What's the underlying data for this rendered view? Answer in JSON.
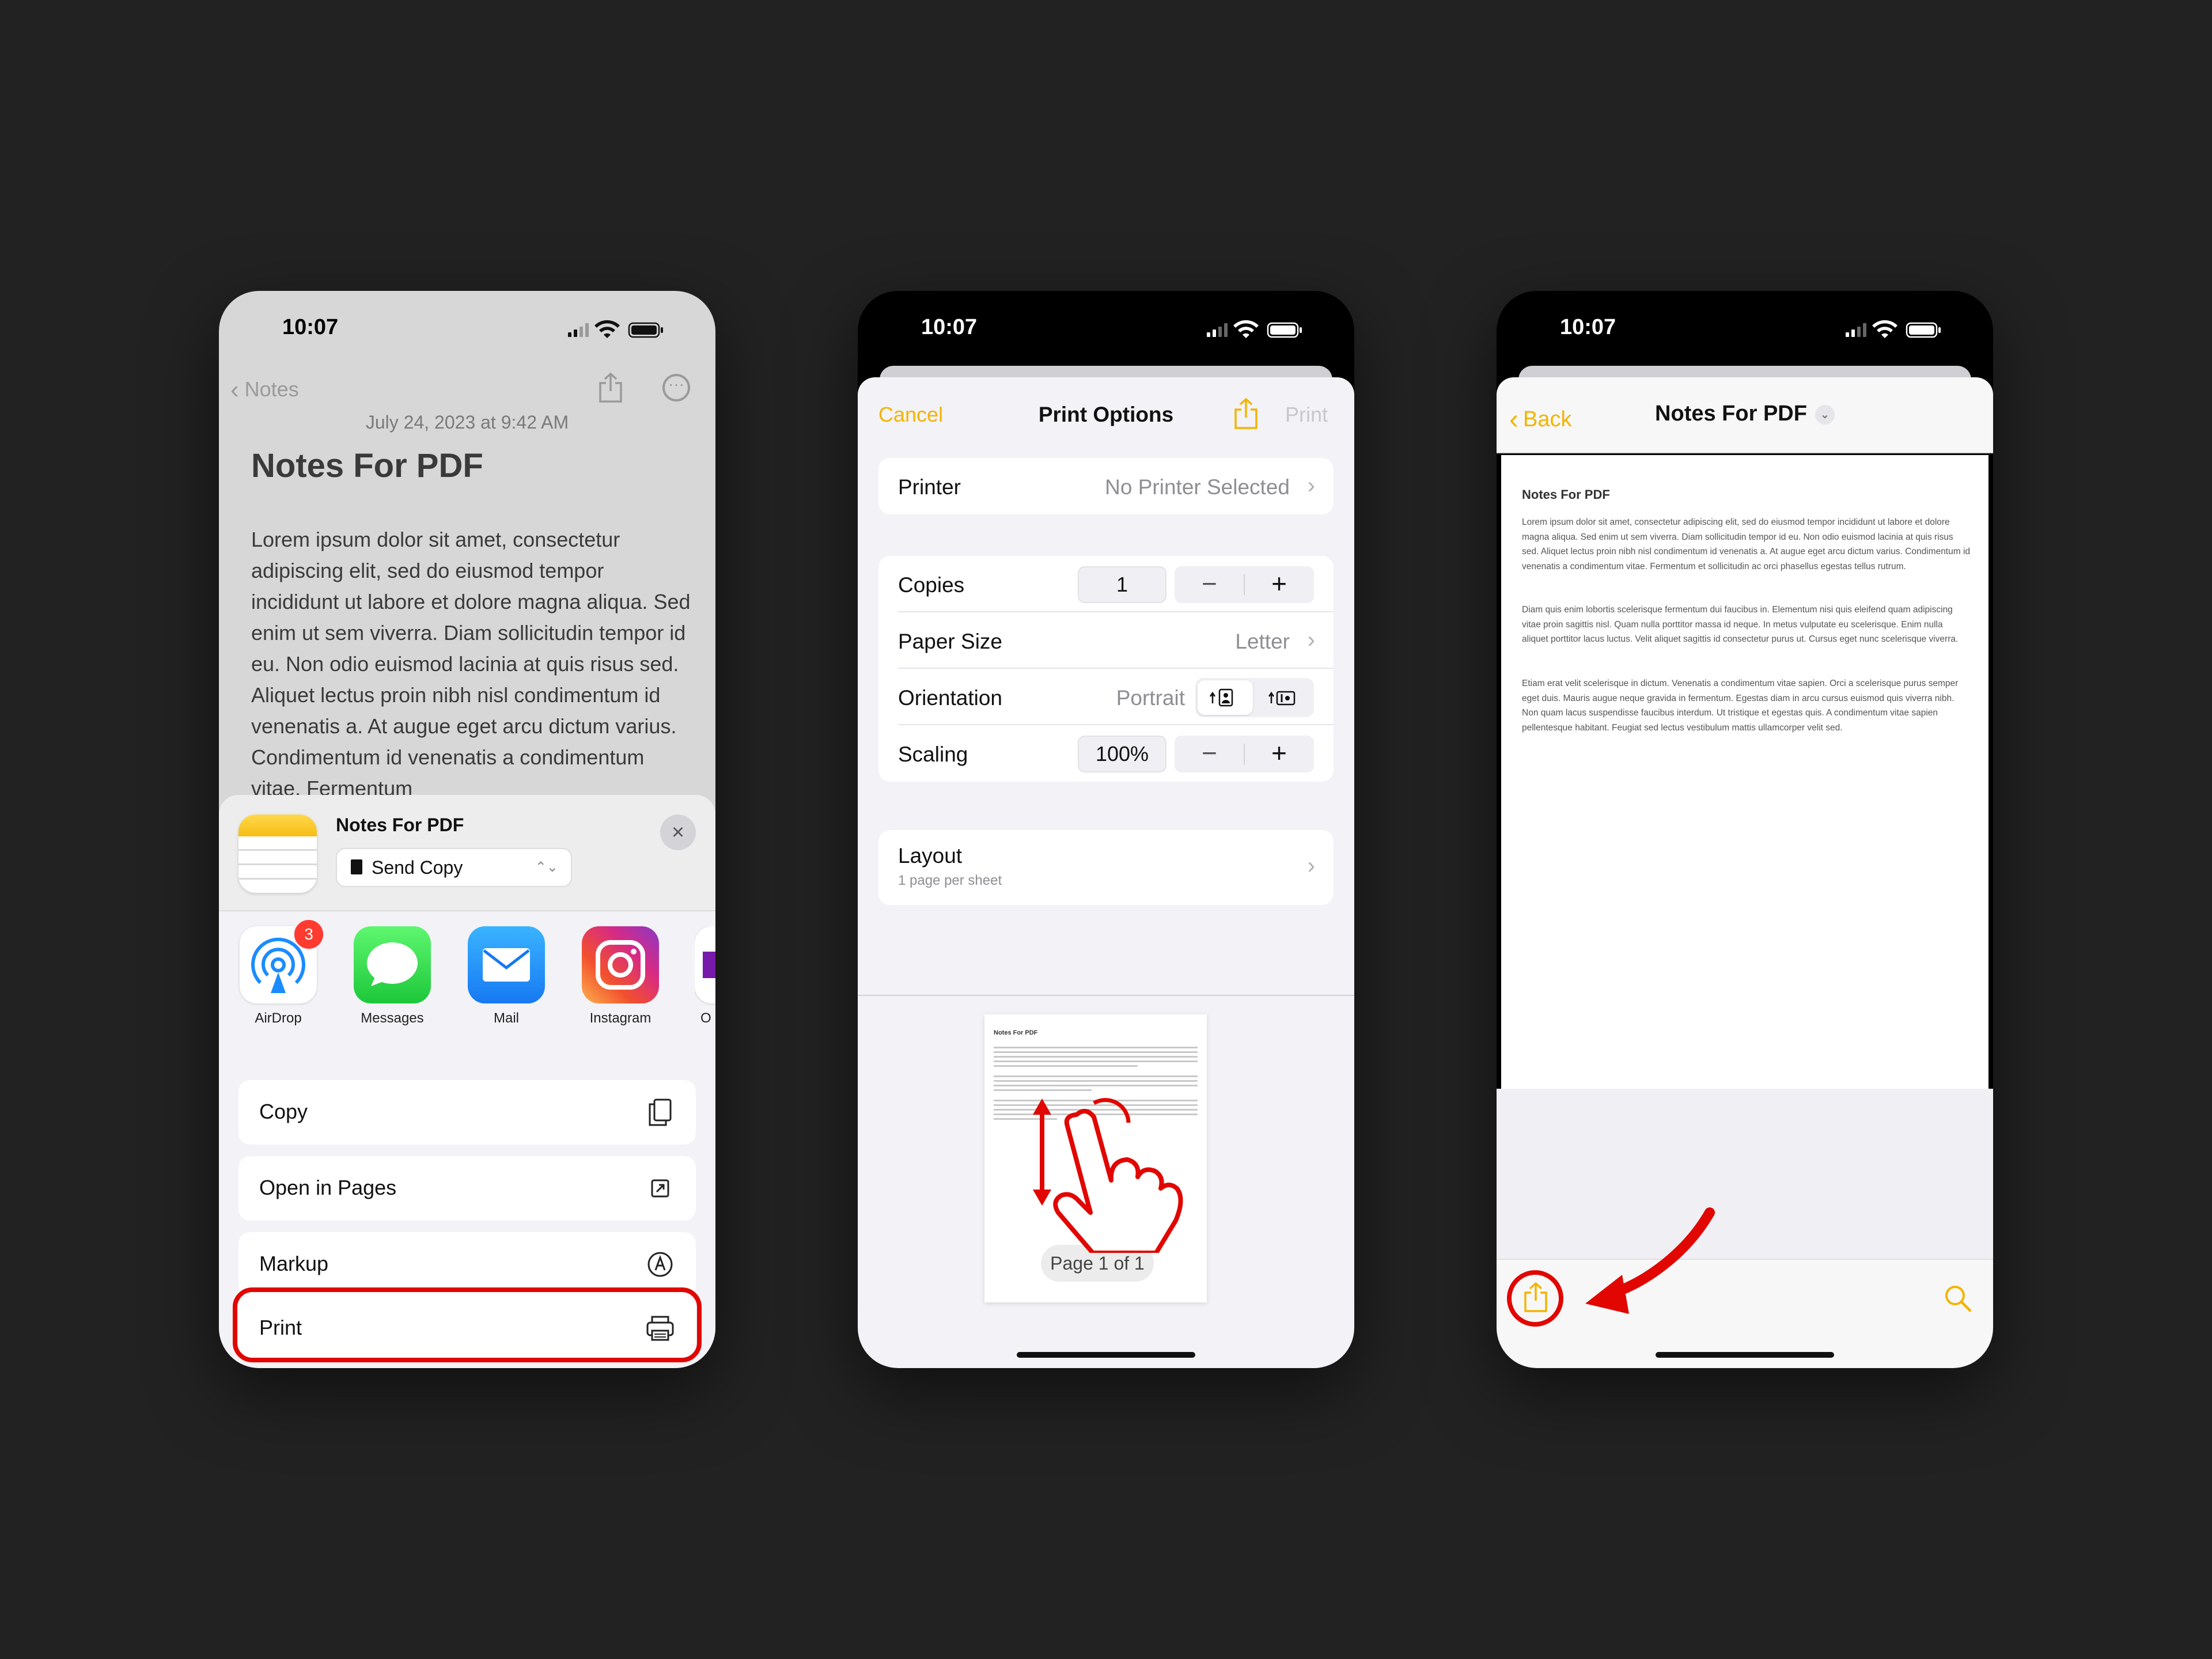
{
  "status_time": "10:07",
  "colors": {
    "accent": "#F4B400",
    "highlight": "#E10600",
    "background": "#222222"
  },
  "phone1": {
    "nav": {
      "back_label": "Notes"
    },
    "date": "July 24, 2023 at 9:42 AM",
    "title": "Notes For PDF",
    "body": "Lorem ipsum dolor sit amet, consectetur adipiscing elit, sed do eiusmod tempor incididunt ut labore et dolore magna aliqua. Sed enim ut sem viverra. Diam sollicitudin tempor id eu. Non odio euismod lacinia at quis risus sed. Aliquet lectus proin nibh nisl condimentum id venenatis a. At augue eget arcu dictum varius. Condimentum id venenatis a condimentum vitae. Fermentum",
    "share_sheet": {
      "title": "Notes For PDF",
      "send_mode": "Send Copy",
      "apps": [
        {
          "label": "AirDrop",
          "badge": "3",
          "icon": "airdrop-icon"
        },
        {
          "label": "Messages",
          "icon": "messages-icon"
        },
        {
          "label": "Mail",
          "icon": "mail-icon"
        },
        {
          "label": "Instagram",
          "icon": "instagram-icon"
        },
        {
          "label": "O",
          "icon": "onenote-icon"
        }
      ],
      "actions": [
        {
          "label": "Copy",
          "icon": "copy-icon"
        },
        {
          "label": "Open in Pages",
          "icon": "open-external-icon"
        },
        {
          "label": "Markup",
          "icon": "markup-icon"
        },
        {
          "label": "Print",
          "icon": "printer-icon"
        }
      ]
    }
  },
  "phone2": {
    "nav": {
      "cancel": "Cancel",
      "title": "Print Options",
      "print": "Print"
    },
    "printer": {
      "label": "Printer",
      "value": "No Printer Selected"
    },
    "copies": {
      "label": "Copies",
      "value": "1"
    },
    "paper_size": {
      "label": "Paper Size",
      "value": "Letter"
    },
    "orientation": {
      "label": "Orientation",
      "value": "Portrait"
    },
    "scaling": {
      "label": "Scaling",
      "value": "100%"
    },
    "layout": {
      "label": "Layout",
      "sub": "1 page per sheet"
    },
    "preview": {
      "doc_title": "Notes For PDF",
      "page_label": "Page 1 of 1"
    }
  },
  "phone3": {
    "nav": {
      "back": "Back",
      "title": "Notes For PDF"
    },
    "document": {
      "title": "Notes For PDF",
      "paragraphs": [
        "Lorem ipsum dolor sit amet, consectetur adipiscing elit, sed do eiusmod tempor incididunt ut labore et dolore magna aliqua. Sed enim ut sem viverra. Diam sollicitudin tempor id eu. Non odio euismod lacinia at quis risus sed. Aliquet lectus proin nibh nisl condimentum id venenatis a. At augue eget arcu dictum varius. Condimentum id venenatis a condimentum vitae. Fermentum et sollicitudin ac orci phasellus egestas tellus rutrum.",
        "Diam quis enim lobortis scelerisque fermentum dui faucibus in. Elementum nisi quis eleifend quam adipiscing vitae proin sagittis nisl. Quam nulla porttitor massa id neque. In metus vulputate eu scelerisque. Enim nulla aliquet porttitor lacus luctus. Velit aliquet sagittis id consectetur purus ut. Cursus eget nunc scelerisque viverra.",
        "Etiam erat velit scelerisque in dictum. Venenatis a condimentum vitae sapien. Orci a scelerisque purus semper eget duis. Mauris augue neque gravida in fermentum. Egestas diam in arcu cursus euismod quis viverra nibh. Non quam lacus suspendisse faucibus interdum. Ut tristique et egestas quis. A condimentum vitae sapien pellentesque habitant. Feugiat sed lectus vestibulum mattis ullamcorper velit sed."
      ]
    }
  }
}
